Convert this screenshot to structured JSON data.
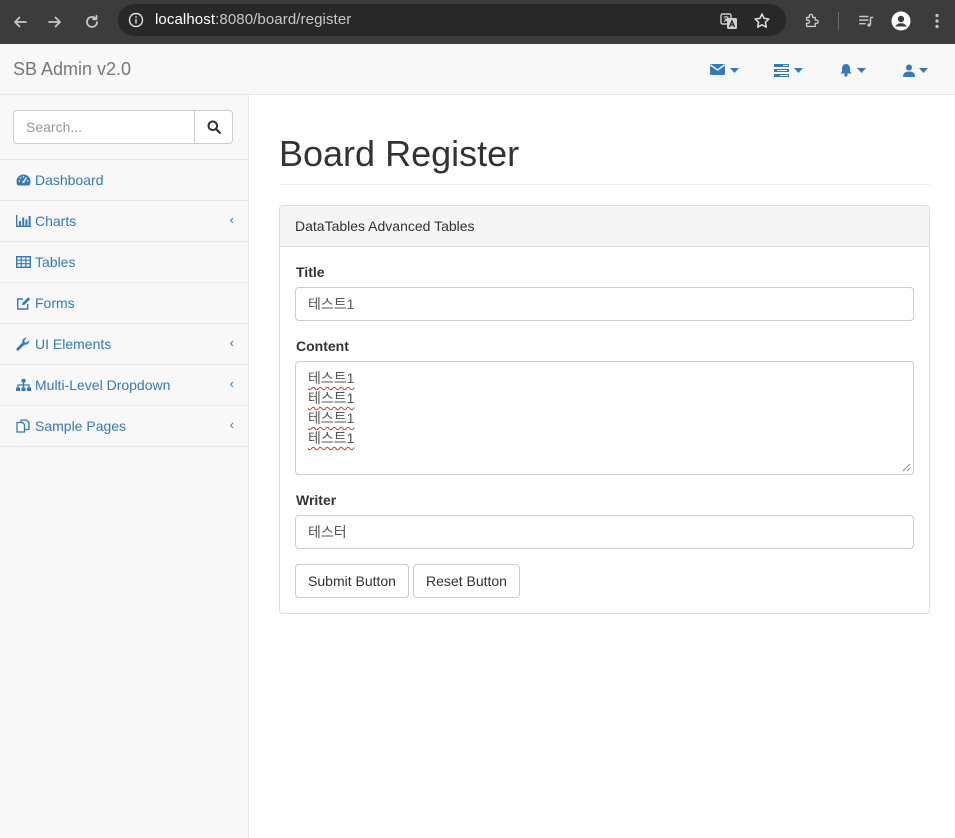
{
  "browser": {
    "url_host": "localhost",
    "url_rest": ":8080/board/register",
    "icons": [
      "back-icon",
      "forward-icon",
      "reload-icon",
      "site-info-icon",
      "translate-icon",
      "bookmark-star-icon",
      "extensions-icon",
      "media-controls-icon",
      "profile-icon",
      "more-menu-icon"
    ]
  },
  "navbar": {
    "brand": "SB Admin v2.0",
    "icons": [
      "envelope-icon",
      "tasks-icon",
      "bell-icon",
      "user-icon"
    ],
    "accent": "#337ab7"
  },
  "sidebar": {
    "search_placeholder": "Search...",
    "items": [
      {
        "label": "Dashboard",
        "icon": "dashboard-icon",
        "has_arrow": false
      },
      {
        "label": "Charts",
        "icon": "bar-chart-icon",
        "has_arrow": true
      },
      {
        "label": "Tables",
        "icon": "table-icon",
        "has_arrow": false
      },
      {
        "label": "Forms",
        "icon": "edit-icon",
        "has_arrow": false
      },
      {
        "label": "UI Elements",
        "icon": "wrench-icon",
        "has_arrow": true
      },
      {
        "label": "Multi-Level Dropdown",
        "icon": "sitemap-icon",
        "has_arrow": true
      },
      {
        "label": "Sample Pages",
        "icon": "files-icon",
        "has_arrow": true
      }
    ],
    "arrow_glyph": "‹"
  },
  "main": {
    "page_title": "Board Register",
    "panel_heading": "DataTables Advanced Tables",
    "form": {
      "title_label": "Title",
      "title_value": "테스트1",
      "content_label": "Content",
      "content_lines": [
        "테스트1",
        "테스트1",
        "테스트1",
        "테스트1"
      ],
      "writer_label": "Writer",
      "writer_value": "테스터",
      "submit_label": "Submit Button",
      "reset_label": "Reset Button"
    }
  }
}
